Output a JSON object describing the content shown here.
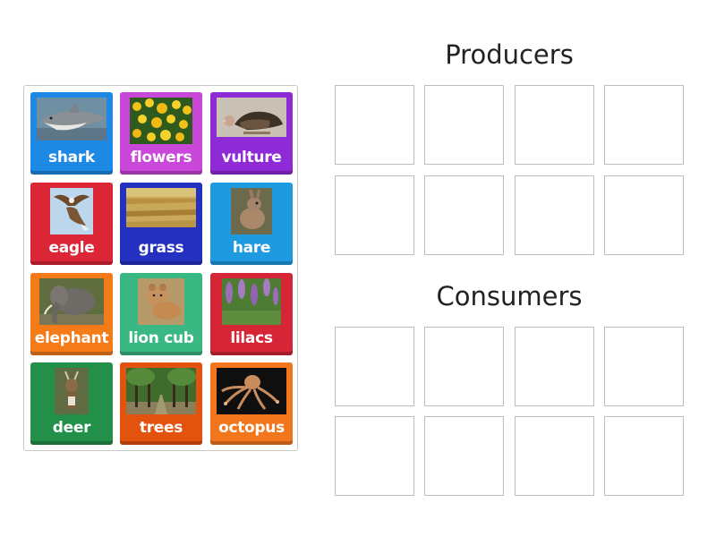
{
  "cards": [
    {
      "label": "shark",
      "color": "#1e88e5",
      "icon": "shark-image"
    },
    {
      "label": "flowers",
      "color": "#c947d9",
      "icon": "flowers-image"
    },
    {
      "label": "vulture",
      "color": "#8e2bd6",
      "icon": "vulture-image"
    },
    {
      "label": "eagle",
      "color": "#dc2637",
      "icon": "eagle-image"
    },
    {
      "label": "grass",
      "color": "#2330c0",
      "icon": "grass-image"
    },
    {
      "label": "hare",
      "color": "#1e9ae0",
      "icon": "hare-image"
    },
    {
      "label": "elephant",
      "color": "#f47b17",
      "icon": "elephant-image"
    },
    {
      "label": "lion cub",
      "color": "#3ab884",
      "icon": "lion-cub-image"
    },
    {
      "label": "lilacs",
      "color": "#d52537",
      "icon": "lilacs-image"
    },
    {
      "label": "deer",
      "color": "#23904a",
      "icon": "deer-image"
    },
    {
      "label": "trees",
      "color": "#e4530d",
      "icon": "trees-image"
    },
    {
      "label": "octopus",
      "color": "#f2761c",
      "icon": "octopus-image"
    }
  ],
  "groups": [
    {
      "title": "Producers",
      "slot_count": 8
    },
    {
      "title": "Consumers",
      "slot_count": 8
    }
  ]
}
